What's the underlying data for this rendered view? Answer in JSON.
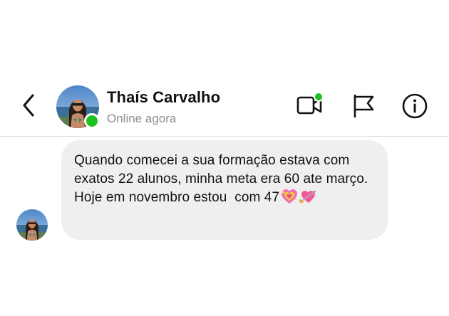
{
  "header": {
    "contact_name": "Thaís Carvalho",
    "status": "Online agora",
    "online": true,
    "icons": {
      "back": "back-arrow-icon",
      "video": "video-call-icon",
      "flag": "flag-icon",
      "info": "info-icon"
    }
  },
  "colors": {
    "online_green": "#1ec21e",
    "bubble_bg": "#efefef",
    "status_gray": "#8e8e8e"
  },
  "messages": [
    {
      "sender": "Thaís Carvalho",
      "text": "Quando comecei a sua formação estava com exatos 22 alunos, minha meta era 60 ate março.  Hoje em novembro estou  com 47",
      "emojis": [
        "sparkling-heart-icon",
        "heart-with-arrow-icon"
      ]
    }
  ]
}
